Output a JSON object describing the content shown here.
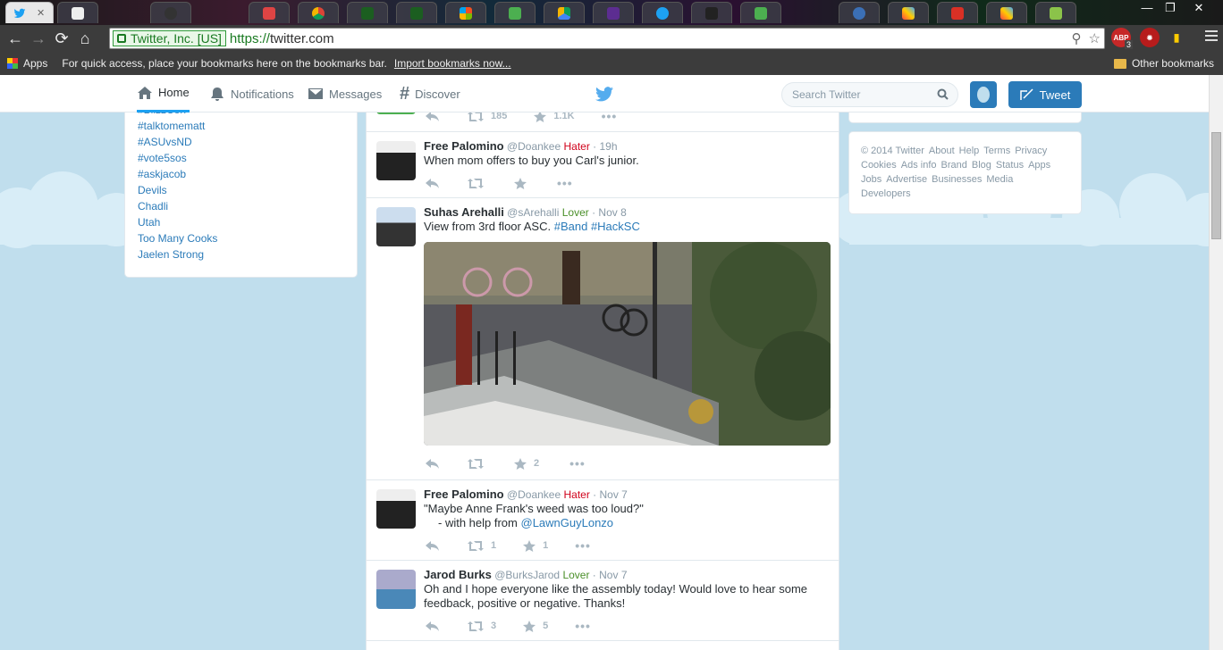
{
  "browser": {
    "address": {
      "identity": "Twitter, Inc. [US]",
      "protocol": "https://",
      "host": "twitter.com"
    },
    "bookmarks": {
      "apps": "Apps",
      "hint": "For quick access, place your bookmarks here on the bookmarks bar.",
      "import": "Import bookmarks now...",
      "other": "Other bookmarks"
    },
    "extension_badge": "3"
  },
  "nav": {
    "home": "Home",
    "notifications": "Notifications",
    "messages": "Messages",
    "discover": "Discover",
    "search_placeholder": "Search Twitter",
    "tweet_button": "Tweet"
  },
  "trends": [
    "#BlizzCon",
    "#talktomematt",
    "#ASUvsND",
    "#vote5sos",
    "#askjacob",
    "Devils",
    "Chadli",
    "Utah",
    "Too Many Cooks",
    "Jaelen Strong"
  ],
  "footer": [
    "© 2014 Twitter",
    "About",
    "Help",
    "Terms",
    "Privacy",
    "Cookies",
    "Ads info",
    "Brand",
    "Blog",
    "Status",
    "Apps",
    "Jobs",
    "Advertise",
    "Businesses",
    "Media",
    "Developers"
  ],
  "tweets": [
    {
      "retweets": "185",
      "favorites": "1.1K"
    },
    {
      "name": "Free Palomino",
      "handle": "@Doankee",
      "tag": "Hater",
      "time": "19h",
      "text": "When mom offers to buy you Carl's junior."
    },
    {
      "name": "Suhas Arehalli",
      "handle": "@sArehalli",
      "tag": "Lover",
      "time": "Nov 8",
      "text": "View from 3rd floor ASC.",
      "hashtags": [
        "#Band",
        "#HackSC"
      ],
      "favorites": "2"
    },
    {
      "name": "Free Palomino",
      "handle": "@Doankee",
      "tag": "Hater",
      "time": "Nov 7",
      "text": "\"Maybe Anne Frank's weed was too loud?\"",
      "credit": "- with help from",
      "mention": "@LawnGuyLonzo",
      "retweets": "1",
      "favorites": "1"
    },
    {
      "name": "Jarod Burks",
      "handle": "@BurksJarod",
      "tag": "Lover",
      "time": "Nov 7",
      "text": "Oh and I hope everyone like the assembly today! Would love to hear some feedback, positive or negative. Thanks!",
      "retweets": "3",
      "favorites": "5"
    }
  ],
  "colors": {
    "accent": "#2b7bb9",
    "hater": "#d0021b",
    "lover": "#4a8f29",
    "background": "#c0deed"
  }
}
